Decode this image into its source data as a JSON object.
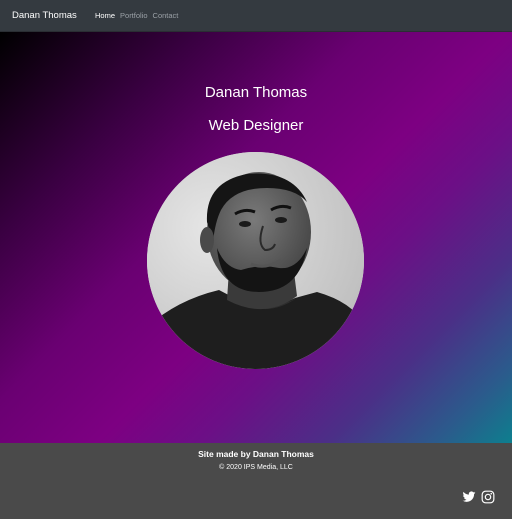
{
  "navbar": {
    "brand": "Danan Thomas",
    "links": [
      {
        "label": "Home",
        "active": true
      },
      {
        "label": "Portfolio",
        "active": false
      },
      {
        "label": "Contact",
        "active": false
      }
    ]
  },
  "hero": {
    "name": "Danan Thomas",
    "role": "Web Designer"
  },
  "footer": {
    "credit": "Site made by Danan Thomas",
    "copyright": "© 2020 IPS Media, LLC",
    "social_icons": [
      "twitter-icon",
      "instagram-icon"
    ]
  },
  "colors": {
    "navbar_bg": "#343a40",
    "footer_bg": "#4a4a4a",
    "gradient_purple": "#7d0082",
    "gradient_teal": "#0d7f8e"
  }
}
